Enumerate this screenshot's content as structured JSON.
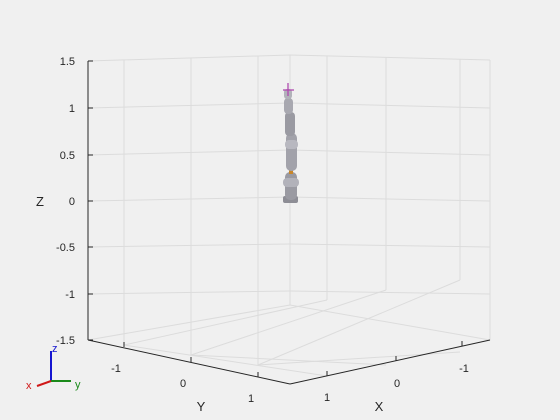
{
  "figure": {
    "background": "#f0f0f0",
    "grid_color": "#dcdcdc",
    "axis_color": "#262626"
  },
  "axes": {
    "z": {
      "label": "Z",
      "range": [
        -1.5,
        1.5
      ],
      "ticks": [
        "1.5",
        "1",
        "0.5",
        "0",
        "-0.5",
        "-1",
        "-1.5"
      ]
    },
    "y": {
      "label": "Y",
      "ticks": [
        "-1",
        "0",
        "1"
      ]
    },
    "x": {
      "label": "X",
      "ticks": [
        "1",
        "0",
        "-1"
      ]
    },
    "grid": true
  },
  "robot": {
    "link_color": "#9a9aa2",
    "joint_accent": "#c8862a",
    "end_effector_marker": "#b04ab0"
  },
  "triad": {
    "z_label": "z",
    "y_label": "y",
    "x_label": "x",
    "z_color": "#1515d0",
    "y_color": "#1a8a1a",
    "x_color": "#d01818"
  }
}
